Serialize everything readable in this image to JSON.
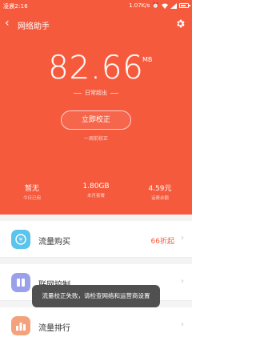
{
  "status": {
    "time": "凌晨2:16",
    "speed": "1.07K/s"
  },
  "header": {
    "title": "网络助手"
  },
  "usage": {
    "value": "82.66",
    "unit": "MB",
    "caption": "日常超出"
  },
  "actions": {
    "calibrate_label": "立即校正",
    "note": "一周前校正"
  },
  "stats": [
    {
      "value": "暂无",
      "label": "今日已用"
    },
    {
      "value": "1.80GB",
      "label": "本月套餐"
    },
    {
      "value": "4.59元",
      "label": "话费余额"
    }
  ],
  "list": [
    {
      "label": "流量购买",
      "extra": "66折起"
    },
    {
      "label": "联网控制"
    },
    {
      "label": "流量排行"
    }
  ],
  "toast": {
    "message": "流量校正失败，请检查网络和运营商设置"
  },
  "colors": {
    "accent": "#f65a3d"
  }
}
